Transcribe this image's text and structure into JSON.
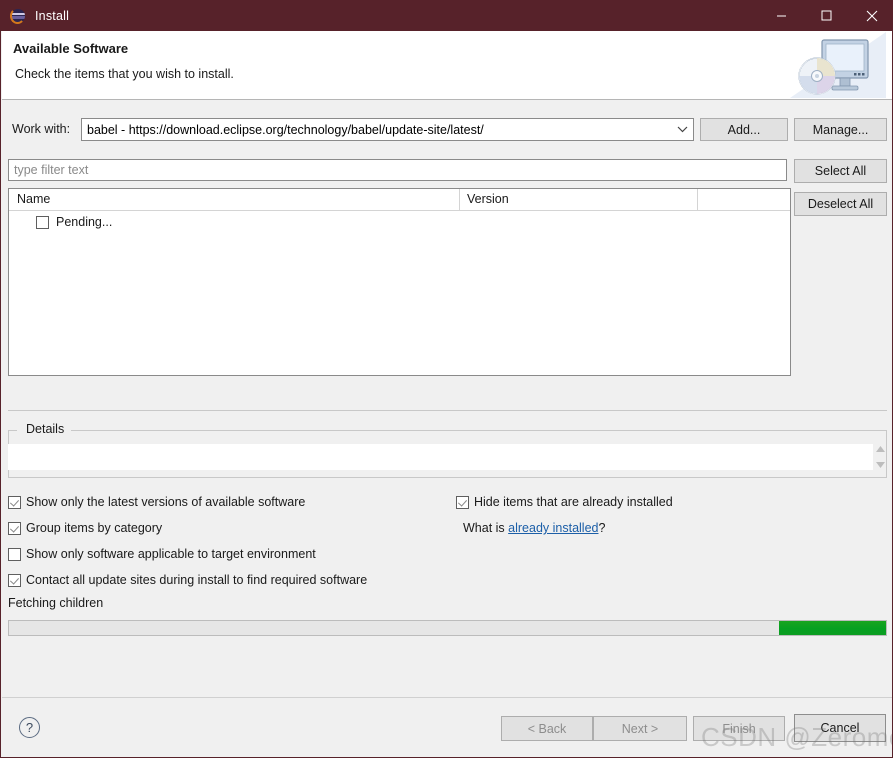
{
  "window": {
    "title": "Install",
    "icon": "eclipse-icon",
    "titlebar_color": "#57222a",
    "minimize_label": "Minimize",
    "maximize_label": "Maximize",
    "close_label": "Close"
  },
  "header": {
    "title": "Available Software",
    "subtitle": "Check the items that you wish to install.",
    "image": "monitor-cd-icon"
  },
  "workwith": {
    "label": "Work with:",
    "value": "babel - https://download.eclipse.org/technology/babel/update-site/latest/",
    "add_label": "Add...",
    "manage_label": "Manage..."
  },
  "filter": {
    "value": "",
    "placeholder": "type filter text"
  },
  "tree": {
    "columns": [
      "Name",
      "Version"
    ],
    "rows": [
      {
        "name": "Pending...",
        "version": "",
        "checked": false
      }
    ],
    "select_all_label": "Select All",
    "deselect_all_label": "Deselect All"
  },
  "details": {
    "legend": "Details",
    "content": ""
  },
  "options": {
    "left": [
      {
        "label": "Show only the latest versions of available software",
        "checked": true
      },
      {
        "label": "Group items by category",
        "checked": true
      },
      {
        "label": "Show only software applicable to target environment",
        "checked": false
      },
      {
        "label": "Contact all update sites during install to find required software",
        "checked": true
      }
    ],
    "right": [
      {
        "label": "Hide items that are already installed",
        "checked": true
      }
    ],
    "whatis_prefix": "What is ",
    "whatis_link": "already installed",
    "whatis_suffix": "?"
  },
  "status": {
    "text": "Fetching children"
  },
  "progress": {
    "indeterminate": true,
    "chunk_color": "#06a021",
    "chunk_percent": 12
  },
  "footer": {
    "help_label": "?",
    "back_label": "< Back",
    "next_label": "Next >",
    "finish_label": "Finish",
    "cancel_label": "Cancel",
    "back_enabled": false,
    "next_enabled": false,
    "finish_enabled": false,
    "cancel_enabled": true
  },
  "watermark": {
    "text": "CSDN @Zeromes"
  }
}
